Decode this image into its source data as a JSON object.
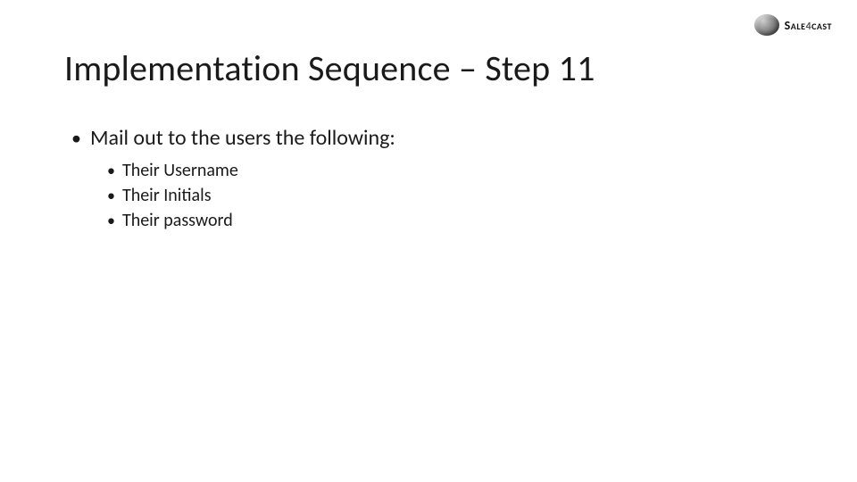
{
  "logo": {
    "brand_part1": "Sale",
    "brand_part2": "4",
    "brand_part3": "cast"
  },
  "title": "Implementation Sequence – Step 11",
  "body": {
    "line1": "Mail out to the users the following:",
    "sub": [
      "Their Username",
      "Their Initials",
      "Their password"
    ]
  }
}
